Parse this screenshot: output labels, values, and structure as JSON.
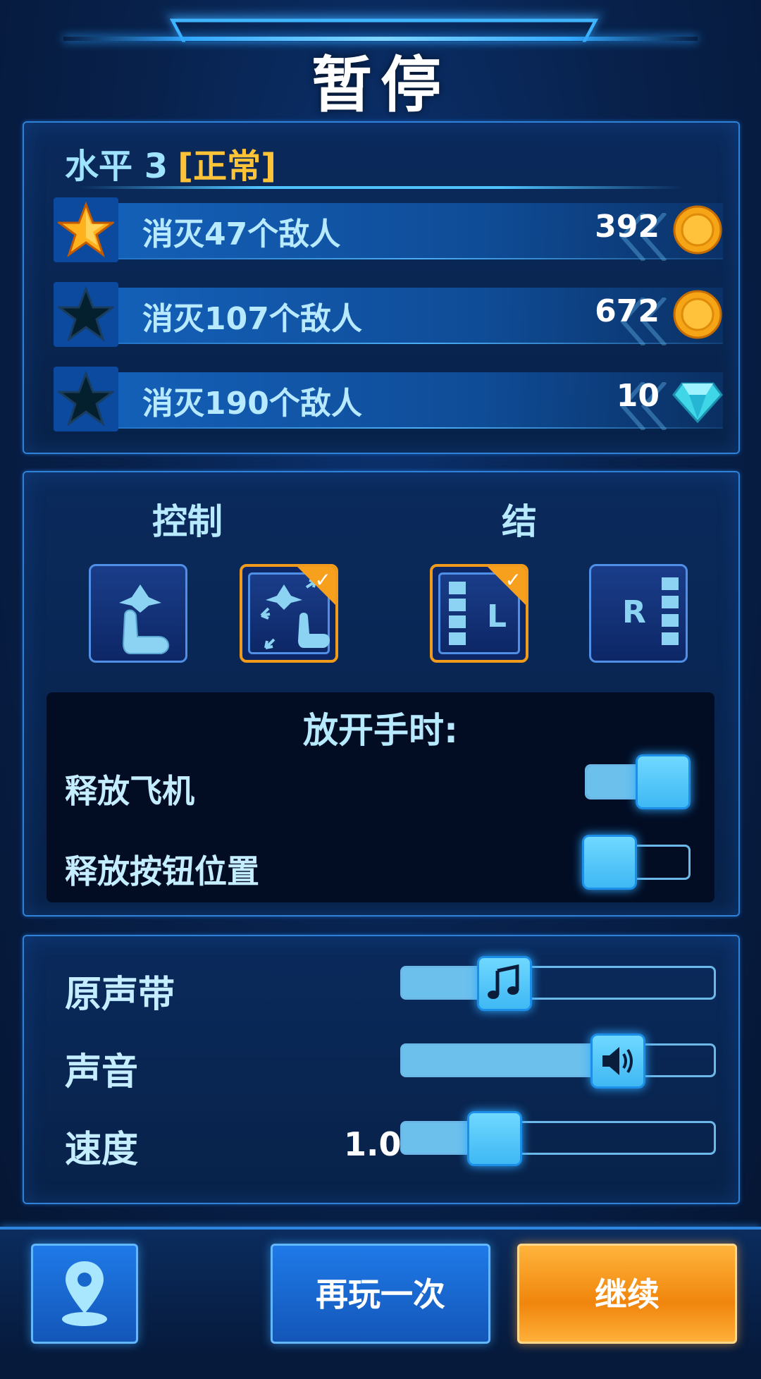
{
  "header": {
    "title": "暂停"
  },
  "level": {
    "prefix": "水平 3",
    "mode": "[正常]"
  },
  "missions": [
    {
      "text": "消灭47个敌人",
      "value": "392",
      "reward_icon": "coin-icon",
      "star": "gold-star-icon"
    },
    {
      "text": "消灭107个敌人",
      "value": "672",
      "reward_icon": "coin-icon",
      "star": "empty-star-icon"
    },
    {
      "text": "消灭190个敌人",
      "value": "10",
      "reward_icon": "gem-icon",
      "star": "empty-star-icon"
    }
  ],
  "controls": {
    "control_label": "控制",
    "layout_label": "结",
    "layout_left": "L",
    "layout_right": "R"
  },
  "release": {
    "heading": "放开手时:",
    "release_plane": "释放飞机",
    "release_plane_on": true,
    "release_button": "释放按钮位置",
    "release_button_on": false
  },
  "audio": {
    "soundtrack_label": "原声带",
    "soundtrack_level": 0.33,
    "sound_label": "声音",
    "sound_level": 0.69,
    "speed_label": "速度",
    "speed_value": "1.0",
    "speed_level": 0.3
  },
  "buttons": {
    "replay": "再玩一次",
    "continue": "继续"
  },
  "colors": {
    "accent_orange": "#f7a01e",
    "accent_blue": "#3fb8f4",
    "level_mode": "#ffc338"
  }
}
